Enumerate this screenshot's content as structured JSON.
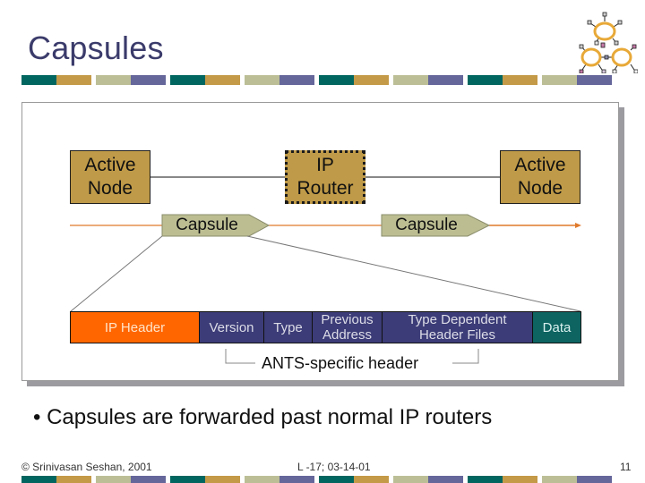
{
  "slide": {
    "title": "Capsules",
    "bullet": "Capsules are forwarded past normal IP routers",
    "bullet_marker": "•"
  },
  "decor": {
    "color_bar": [
      "#00665f",
      "#c49a48",
      "#bcbf96",
      "#65669a"
    ],
    "logo_icon": "network-nodes-icon"
  },
  "diagram": {
    "nodes": [
      {
        "label_line1": "Active",
        "label_line2": "Node",
        "style": "solid"
      },
      {
        "label_line1": "IP",
        "label_line2": "Router",
        "style": "dotted"
      },
      {
        "label_line1": "Active",
        "label_line2": "Node",
        "style": "solid"
      }
    ],
    "capsules": [
      "Capsule",
      "Capsule"
    ],
    "fields": [
      {
        "line1": "IP Header",
        "line2": "",
        "color": "#ff6600"
      },
      {
        "line1": "Version",
        "line2": "",
        "color": "#3c3c78"
      },
      {
        "line1": "Type",
        "line2": "",
        "color": "#3c3c78"
      },
      {
        "line1": "Previous",
        "line2": "Address",
        "color": "#3c3c78"
      },
      {
        "line1": "Type Dependent",
        "line2": "Header Files",
        "color": "#3c3c78"
      },
      {
        "line1": "Data",
        "line2": "",
        "color": "#0d6461"
      }
    ],
    "bracket_label": "ANTS-specific header",
    "colors": {
      "node_fill": "#bf9a48",
      "capsule_fill": "#bcbe92",
      "flow_arrow": "#e07a2c"
    }
  },
  "footer": {
    "copyright": "© Srinivasan Seshan, 2001",
    "lecture": "L -17; 03-14-01",
    "page_number": "11"
  }
}
